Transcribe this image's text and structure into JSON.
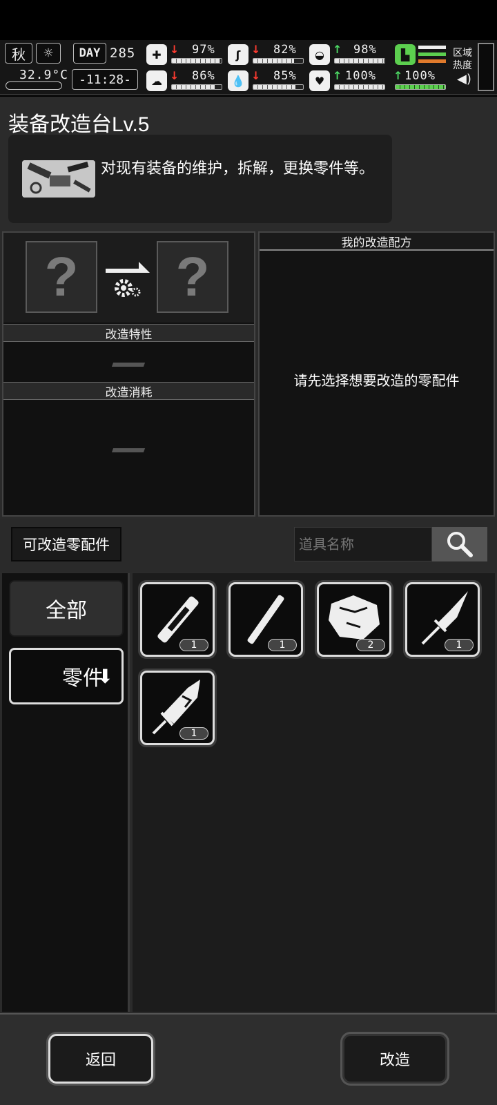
{
  "hud": {
    "season": "秋",
    "temperature": "32.9°C",
    "day_label": "DAY",
    "day_value": "285",
    "clock": "-11:28-",
    "stats": [
      {
        "name": "health",
        "value": "97%",
        "trend": "down",
        "level": 0.97
      },
      {
        "name": "hunger",
        "value": "82%",
        "trend": "down",
        "level": 0.82
      },
      {
        "name": "armor",
        "value": "98%",
        "trend": "up",
        "level": 0.98
      },
      {
        "name": "mental",
        "value": "86%",
        "trend": "down",
        "level": 0.86
      },
      {
        "name": "thirst",
        "value": "85%",
        "trend": "down",
        "level": 0.85
      },
      {
        "name": "heart",
        "value": "100%",
        "trend": "up",
        "level": 1.0
      },
      {
        "name": "stamina",
        "value": "100%",
        "trend": "up",
        "level": 1.0
      }
    ],
    "zone_heat_label": "区域\n热度"
  },
  "workshop": {
    "title": "装备改造台Lv.5",
    "description": "对现有装备的维护，拆解，更换零件等。",
    "slot_placeholder": "?",
    "traits_header": "改造特性",
    "cost_header": "改造消耗",
    "recipes_header": "我的改造配方",
    "recipes_empty": "请先选择想要改造的零配件"
  },
  "toolbar": {
    "tab_label": "可改造零配件",
    "search_placeholder": "道具名称"
  },
  "categories": [
    {
      "label": "全部"
    },
    {
      "label": "零件"
    }
  ],
  "items": [
    {
      "icon": "tube-part-icon",
      "count": "1"
    },
    {
      "icon": "rod-part-icon",
      "count": "1"
    },
    {
      "icon": "stone-chunk-icon",
      "count": "2"
    },
    {
      "icon": "crystal-dagger-icon",
      "count": "1"
    },
    {
      "icon": "crystal-blade-icon",
      "count": "1"
    }
  ],
  "footer": {
    "back_label": "返回",
    "modify_label": "改造"
  }
}
